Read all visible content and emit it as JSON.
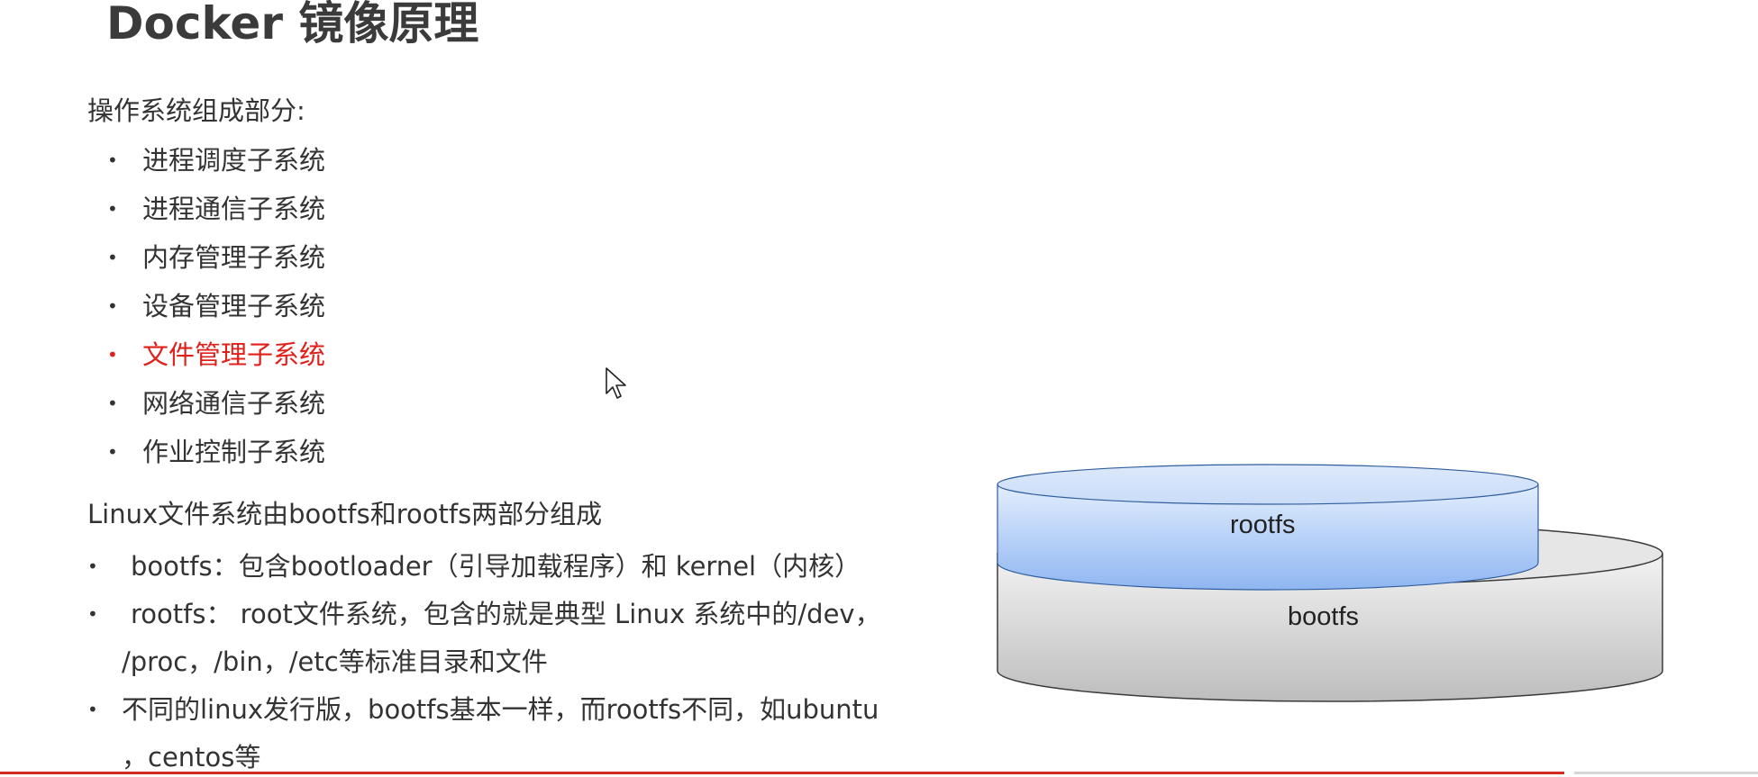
{
  "title": "Docker 镜像原理",
  "os_section": {
    "heading": "操作系统组成部分:",
    "items": [
      {
        "label": "进程调度子系统",
        "highlight": false
      },
      {
        "label": "进程通信子系统",
        "highlight": false
      },
      {
        "label": "内存管理子系统",
        "highlight": false
      },
      {
        "label": "设备管理子系统",
        "highlight": false
      },
      {
        "label": "文件管理子系统",
        "highlight": true
      },
      {
        "label": "网络通信子系统",
        "highlight": false
      },
      {
        "label": "作业控制子系统",
        "highlight": false
      }
    ],
    "highlight_color": "#e0201a"
  },
  "fs_section": {
    "heading": "Linux文件系统由bootfs和rootfs两部分组成",
    "items": [
      {
        "lines": [
          "bootfs：包含bootloader（引导加载程序）和 kernel（内核）"
        ]
      },
      {
        "lines": [
          "rootfs： root文件系统，包含的就是典型 Linux 系统中的/dev，",
          "/proc，/bin，/etc等标准目录和文件"
        ]
      },
      {
        "lines": [
          "不同的linux发行版，bootfs基本一样，而rootfs不同，如ubuntu",
          "，centos等"
        ]
      }
    ]
  },
  "diagram": {
    "top_layer": {
      "label": "rootfs",
      "color": "#a9c8f7"
    },
    "bottom_layer": {
      "label": "bootfs",
      "color": "#d8d8d8"
    }
  },
  "bullet_glyph": "•",
  "accent_bar_color": "#d12a1f"
}
